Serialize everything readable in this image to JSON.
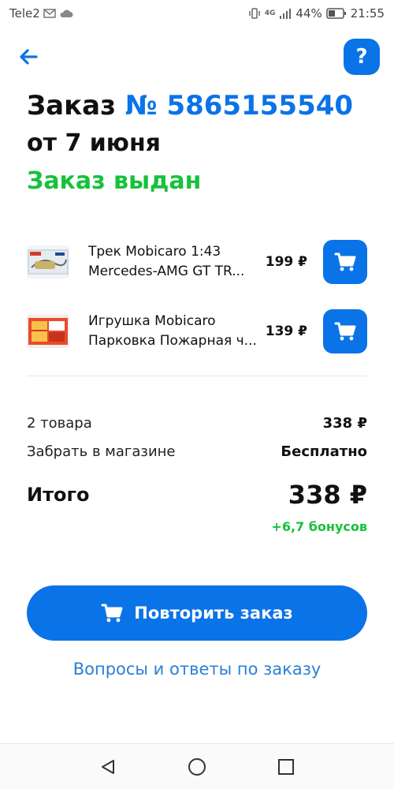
{
  "status_bar": {
    "carrier": "Tele2",
    "network": "4G",
    "battery": "44%",
    "time": "21:55"
  },
  "header": {
    "back_icon": "arrow-left-icon",
    "help_label": "?"
  },
  "order": {
    "title_prefix": "Заказ",
    "number": "№ 5865155540",
    "date": "от 7 июня",
    "status": "Заказ выдан"
  },
  "items": [
    {
      "name_line1": "Трек Mobicaro 1:43",
      "name_line2": "Mercedes-AMG GT TR...",
      "price": "199 ₽",
      "cart_icon": "cart-icon"
    },
    {
      "name_line1": "Игрушка Mobicaro",
      "name_line2": "Парковка Пожарная ч...",
      "price": "139 ₽",
      "cart_icon": "cart-icon"
    }
  ],
  "summary": {
    "items_label": "2 товара",
    "items_value": "338 ₽",
    "pickup_label": "Забрать в магазине",
    "pickup_value": "Бесплатно",
    "total_label": "Итого",
    "total_value": "338 ₽",
    "bonus": "+6,7 бонусов"
  },
  "actions": {
    "repeat_label": "Повторить заказ",
    "faq_label": "Вопросы и ответы по заказу"
  },
  "colors": {
    "accent": "#0a73e8",
    "success": "#16c23b",
    "link": "#2b7fd6"
  }
}
